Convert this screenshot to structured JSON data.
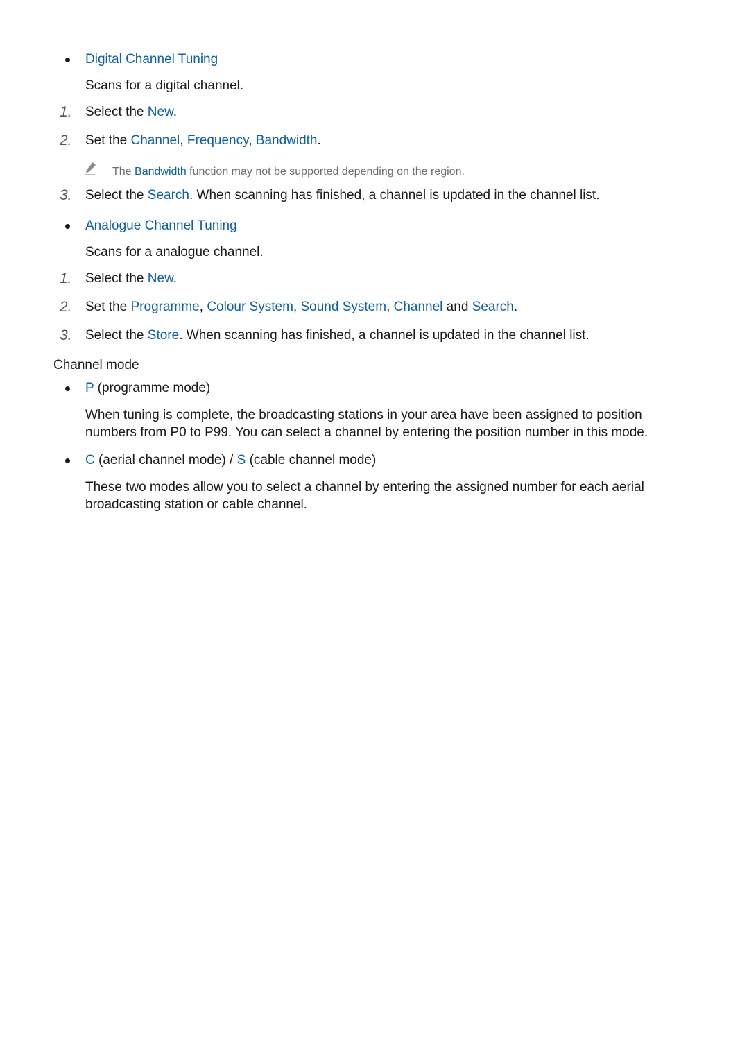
{
  "digital": {
    "heading": "Digital Channel Tuning",
    "desc": "Scans for a digital channel.",
    "steps": [
      {
        "num": "1.",
        "pre": "Select the ",
        "k1": "New",
        "post": "."
      },
      {
        "num": "2.",
        "pre": "Set the ",
        "k1": "Channel",
        "sep1": ", ",
        "k2": "Frequency",
        "sep2": ", ",
        "k3": "Bandwidth",
        "post": "."
      },
      {
        "num": "3.",
        "pre": "Select the ",
        "k1": "Search",
        "post": ". When scanning has finished, a channel is updated in the channel list."
      }
    ],
    "note": {
      "icon": "pencil-icon",
      "pre": "The ",
      "k1": "Bandwidth",
      "post": " function may not be supported depending on the region."
    }
  },
  "analogue": {
    "heading": "Analogue Channel Tuning",
    "desc": "Scans for a analogue channel.",
    "steps": [
      {
        "num": "1.",
        "pre": "Select the ",
        "k1": "New",
        "post": "."
      },
      {
        "num": "2.",
        "pre": "Set the ",
        "k1": "Programme",
        "sep1": ", ",
        "k2": "Colour System",
        "sep2": ", ",
        "k3": "Sound System",
        "sep3": ", ",
        "k4": "Channel",
        "sep4": " and ",
        "k5": "Search",
        "post": "."
      },
      {
        "num": "3.",
        "pre": "Select the ",
        "k1": "Store",
        "post": ". When scanning has finished, a channel is updated in the channel list."
      }
    ]
  },
  "channel_mode": {
    "title": "Channel mode",
    "items": [
      {
        "k1": "P",
        "text1": " (programme mode)",
        "desc": "When tuning is complete, the broadcasting stations in your area have been assigned to position numbers from P0 to P99. You can select a channel by entering the position number in this mode."
      },
      {
        "k1": "C",
        "text1": " (aerial channel mode) / ",
        "k2": "S",
        "text2": " (cable channel mode)",
        "desc": "These two modes allow you to select a channel by entering the assigned number for each aerial broadcasting station or cable channel."
      }
    ]
  },
  "colors": {
    "accent": "#0d5fa8",
    "text": "#1a1a1a",
    "note": "#6e6e6e"
  }
}
